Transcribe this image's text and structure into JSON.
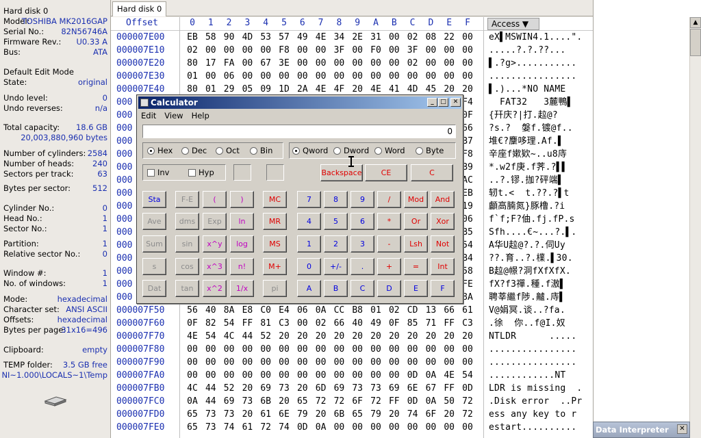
{
  "info": [
    {
      "k": "Hard disk 0",
      "v": ""
    },
    {
      "k": "Model:",
      "v": "TOSHIBA MK2016GAP"
    },
    {
      "k": "Serial No.:",
      "v": "82N56746A"
    },
    {
      "k": "Firmware Rev.:",
      "v": "U0.33 A"
    },
    {
      "k": "Bus:",
      "v": "ATA"
    },
    {
      "k": "Default Edit Mode",
      "v": ""
    },
    {
      "k": "State:",
      "v": "original"
    },
    {
      "k": "Undo level:",
      "v": "0"
    },
    {
      "k": "Undo reverses:",
      "v": "n/a"
    },
    {
      "k": "Total capacity:",
      "v": "18.6 GB"
    },
    {
      "k": "",
      "v": "20,003,880,960 bytes"
    },
    {
      "k": "Number of cylinders:",
      "v": "2584"
    },
    {
      "k": "Number of heads:",
      "v": "240"
    },
    {
      "k": "Sectors per track:",
      "v": "63"
    },
    {
      "k": "Bytes per sector:",
      "v": "512"
    },
    {
      "k": "Cylinder No.:",
      "v": "0"
    },
    {
      "k": "Head No.:",
      "v": "1"
    },
    {
      "k": "Sector No.:",
      "v": "1"
    },
    {
      "k": "Partition:",
      "v": "1"
    },
    {
      "k": "Relative sector No.:",
      "v": "0"
    },
    {
      "k": "Window #:",
      "v": "1"
    },
    {
      "k": "No. of windows:",
      "v": "1"
    },
    {
      "k": "Mode:",
      "v": "hexadecimal"
    },
    {
      "k": "Character set:",
      "v": "ANSI ASCII"
    },
    {
      "k": "Offsets:",
      "v": "hexadecimal"
    },
    {
      "k": "Bytes per page:",
      "v": "31x16=496"
    },
    {
      "k": "Clipboard:",
      "v": "empty"
    },
    {
      "k": "TEMP folder:",
      "v": "3.5 GB free"
    },
    {
      "k": "",
      "v": "NI~1.000\\LOCALS~1\\Temp"
    }
  ],
  "tab": "Hard disk 0",
  "hex_header": {
    "offset": "Offset",
    "cols": [
      "0",
      "1",
      "2",
      "3",
      "4",
      "5",
      "6",
      "7",
      "8",
      "9",
      "A",
      "B",
      "C",
      "D",
      "E",
      "F"
    ],
    "access": "Access"
  },
  "rows": [
    {
      "off": "000007E00",
      "b": [
        "EB",
        "58",
        "90",
        "4D",
        "53",
        "57",
        "49",
        "4E",
        "34",
        "2E",
        "31",
        "00",
        "02",
        "08",
        "22",
        "00"
      ],
      "t": "eX▌MSWIN4.1....\"."
    },
    {
      "off": "000007E10",
      "b": [
        "02",
        "00",
        "00",
        "00",
        "00",
        "F8",
        "00",
        "00",
        "3F",
        "00",
        "F0",
        "00",
        "3F",
        "00",
        "00",
        "00"
      ],
      "t": ".....?.?.??..."
    },
    {
      "off": "000007E20",
      "b": [
        "80",
        "17",
        "FA",
        "00",
        "67",
        "3E",
        "00",
        "00",
        "00",
        "00",
        "00",
        "00",
        "02",
        "00",
        "00",
        "00"
      ],
      "t": "▌.?g>..........."
    },
    {
      "off": "000007E30",
      "b": [
        "01",
        "00",
        "06",
        "00",
        "00",
        "00",
        "00",
        "00",
        "00",
        "00",
        "00",
        "00",
        "00",
        "00",
        "00",
        "00"
      ],
      "t": "................"
    },
    {
      "off": "000007E40",
      "b": [
        "80",
        "01",
        "29",
        "05",
        "09",
        "1D",
        "2A",
        "4E",
        "4F",
        "20",
        "4E",
        "41",
        "4D",
        "45",
        "20",
        "20"
      ],
      "t": "▌.)...*NO NAME"
    },
    {
      "off": "000",
      "b": [],
      "t": "  FAT32   3麓鴨▌",
      "tail": "F4"
    },
    {
      "off": "000",
      "b": [],
      "t": "{幵庆?|打.趇@?",
      "tail": "0F"
    },
    {
      "off": "000",
      "b": [],
      "t": "?s.?  媻f.镀@f..",
      "tail": "66"
    },
    {
      "off": "000",
      "b": [],
      "t": "堆€?麜哆理.Af.▌",
      "tail": "B7"
    },
    {
      "off": "000",
      "b": [],
      "t": "辛座f嫰欵~..u8庤",
      "tail": "F8"
    },
    {
      "off": "000",
      "b": [],
      "t": "*.w2f庚.f荠.?▌▌",
      "tail": "B9"
    },
    {
      "off": "000",
      "b": [],
      "t": "..?.镠.拁?砰端▌",
      "tail": "AC"
    },
    {
      "off": "000",
      "b": [],
      "t": "轫t.<  t.??.?▌t",
      "tail": "EB"
    },
    {
      "off": "000",
      "b": [],
      "t": "顱高腩氮}豚橹.?i",
      "tail": "19"
    },
    {
      "off": "000",
      "b": [],
      "t": "f`f;F?伷.fj.fP.s",
      "tail": "06"
    },
    {
      "off": "000",
      "b": [],
      "t": "Sfh....€~...?.▌.",
      "tail": "B5"
    },
    {
      "off": "000",
      "b": [],
      "t": "A华U趇@?.?.伺Uy",
      "tail": "54"
    },
    {
      "off": "000",
      "b": [],
      "t": "??.育..?.檏.▌30.",
      "tail": "B4"
    },
    {
      "off": "000",
      "b": [],
      "t": "B趇@幜?洞fXfXfX.",
      "tail": "58"
    },
    {
      "off": "000",
      "b": [],
      "t": "fX?f3禪.種.f滶▌",
      "tail": "FE"
    },
    {
      "off": "000",
      "b": [],
      "t": "聘莘繼f陟.齇.庤▌",
      "tail": "8A"
    },
    {
      "off": "000007F50",
      "b": [
        "56",
        "40",
        "8A",
        "E8",
        "C0",
        "E4",
        "06",
        "0A",
        "CC",
        "B8",
        "01",
        "02",
        "CD",
        "13",
        "66",
        "61"
      ],
      "t": "V@娟冥.谈..?fa."
    },
    {
      "off": "000007F60",
      "b": [
        "0F",
        "82",
        "54",
        "FF",
        "81",
        "C3",
        "00",
        "02",
        "66",
        "40",
        "49",
        "0F",
        "85",
        "71",
        "FF",
        "C3"
      ],
      "t": ".徐  你..f@I.奴"
    },
    {
      "off": "000007F70",
      "b": [
        "4E",
        "54",
        "4C",
        "44",
        "52",
        "20",
        "20",
        "20",
        "20",
        "20",
        "20",
        "20",
        "20",
        "20",
        "20",
        "20"
      ],
      "t": "NTLDR      ....."
    },
    {
      "off": "000007F80",
      "b": [
        "00",
        "00",
        "00",
        "00",
        "00",
        "00",
        "00",
        "00",
        "00",
        "00",
        "00",
        "00",
        "00",
        "00",
        "00",
        "00"
      ],
      "t": "................"
    },
    {
      "off": "000007F90",
      "b": [
        "00",
        "00",
        "00",
        "00",
        "00",
        "00",
        "00",
        "00",
        "00",
        "00",
        "00",
        "00",
        "00",
        "00",
        "00",
        "00"
      ],
      "t": "................"
    },
    {
      "off": "000007FA0",
      "b": [
        "00",
        "00",
        "00",
        "00",
        "00",
        "00",
        "00",
        "00",
        "00",
        "00",
        "00",
        "00",
        "0D",
        "0A",
        "4E",
        "54"
      ],
      "t": "............NT"
    },
    {
      "off": "000007FB0",
      "b": [
        "4C",
        "44",
        "52",
        "20",
        "69",
        "73",
        "20",
        "6D",
        "69",
        "73",
        "73",
        "69",
        "6E",
        "67",
        "FF",
        "0D"
      ],
      "t": "LDR is missing  ."
    },
    {
      "off": "000007FC0",
      "b": [
        "0A",
        "44",
        "69",
        "73",
        "6B",
        "20",
        "65",
        "72",
        "72",
        "6F",
        "72",
        "FF",
        "0D",
        "0A",
        "50",
        "72"
      ],
      "t": ".Disk error  ..Pr"
    },
    {
      "off": "000007FD0",
      "b": [
        "65",
        "73",
        "73",
        "20",
        "61",
        "6E",
        "79",
        "20",
        "6B",
        "65",
        "79",
        "20",
        "74",
        "6F",
        "20",
        "72"
      ],
      "t": "ess any key to r"
    },
    {
      "off": "000007FE0",
      "b": [
        "65",
        "73",
        "74",
        "61",
        "72",
        "74",
        "0D",
        "0A",
        "00",
        "00",
        "00",
        "00",
        "00",
        "00",
        "00",
        "00"
      ],
      "t": "estart.........."
    }
  ],
  "calc": {
    "title": "Calculator",
    "menu": [
      "Edit",
      "View",
      "Help"
    ],
    "display": "0",
    "bases": [
      {
        "l": "Hex",
        "on": true
      },
      {
        "l": "Dec",
        "on": false
      },
      {
        "l": "Oct",
        "on": false
      },
      {
        "l": "Bin",
        "on": false
      }
    ],
    "sizes": [
      {
        "l": "Qword",
        "on": true
      },
      {
        "l": "Dword",
        "on": false
      },
      {
        "l": "Word",
        "on": false
      },
      {
        "l": "Byte",
        "on": false
      }
    ],
    "inv": "Inv",
    "hyp": "Hyp",
    "top_buttons": [
      {
        "l": "Backspace",
        "c": "red"
      },
      {
        "l": "CE",
        "c": "red"
      },
      {
        "l": "C",
        "c": "red"
      }
    ],
    "sci": [
      [
        "Sta",
        "F-E",
        "(",
        ")"
      ],
      [
        "Ave",
        "dms",
        "Exp",
        "ln"
      ],
      [
        "Sum",
        "sin",
        "x^y",
        "log"
      ],
      [
        "s",
        "cos",
        "x^3",
        "n!"
      ],
      [
        "Dat",
        "tan",
        "x^2",
        "1/x"
      ]
    ],
    "mem": [
      "MC",
      "MR",
      "MS",
      "M+",
      "pi"
    ],
    "pad": [
      [
        "7",
        "8",
        "9",
        "/",
        "Mod",
        "And"
      ],
      [
        "4",
        "5",
        "6",
        "*",
        "Or",
        "Xor"
      ],
      [
        "1",
        "2",
        "3",
        "-",
        "Lsh",
        "Not"
      ],
      [
        "0",
        "+/-",
        ".",
        "+",
        "=",
        "Int"
      ],
      [
        "A",
        "B",
        "C",
        "D",
        "E",
        "F"
      ]
    ]
  },
  "data_interpreter": "Data Interpreter"
}
